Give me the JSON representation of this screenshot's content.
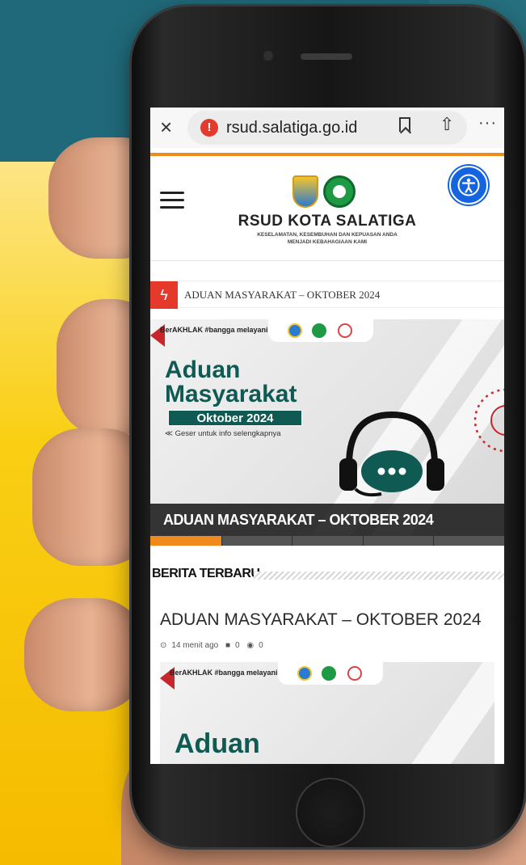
{
  "browser": {
    "close_label": "×",
    "warning_glyph": "!",
    "url": "rsud.salatiga.go.id",
    "share_glyph": "⇧",
    "more_glyph": "···"
  },
  "header": {
    "title": "RSUD KOTA SALATIGA",
    "tagline_line1": "KESELAMATAN, KESEMBUHAN DAN KEPUASAN ANDA",
    "tagline_line2": "MENJADI KEBAHAGIAAN KAMI"
  },
  "ticker": {
    "icon": "lightning-icon",
    "text": "ADUAN MASYARAKAT – OKTOBER 2024"
  },
  "slider": {
    "brand_text": "BerAKHLAK #bangga melayani bangsa",
    "headline_line1": "Aduan",
    "headline_line2": "Masyarakat",
    "badge": "Oktober 2024",
    "subtext": "≪ Geser untuk info selengkapnya",
    "caption": "ADUAN MASYARAKAT – OKTOBER 2024",
    "progress_fraction": 0.2,
    "segments": 5
  },
  "latest": {
    "section_title": "BERITA TERBARU",
    "post_title": "ADUAN MASYARAKAT – OKTOBER 2024",
    "time_ago": "14 menit ago",
    "comments": "0",
    "views": "0",
    "thumb_brand": "BerAKHLAK #bangga melayani bangsa",
    "thumb_headline": "Aduan"
  },
  "colors": {
    "accent": "#f08a1c",
    "ticker_red": "#e53a2b",
    "brand_green": "#0f5a52",
    "access_blue": "#1463e0"
  }
}
